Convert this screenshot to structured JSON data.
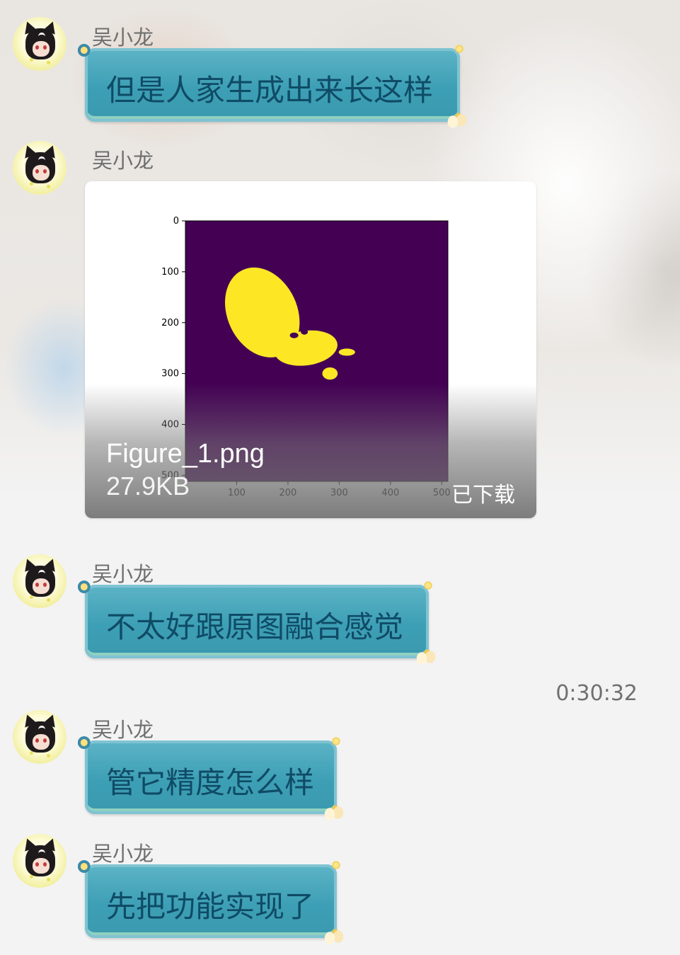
{
  "messages": [
    {
      "sender": "吴小龙",
      "text": "但是人家生成出来长这样"
    },
    {
      "sender": "吴小龙",
      "file": {
        "name": "Figure_1.png",
        "size": "27.9KB",
        "status": "已下载"
      }
    },
    {
      "sender": "吴小龙",
      "text": "不太好跟原图融合感觉"
    },
    {
      "sender": "吴小龙",
      "text": "管它精度怎么样"
    },
    {
      "sender": "吴小龙",
      "text": "先把功能实现了"
    }
  ],
  "timestamp": "0:30:32",
  "chart_data": {
    "type": "heatmap",
    "title": "",
    "xlabel": "",
    "ylabel": "",
    "xticks": [
      "100",
      "200",
      "300",
      "400",
      "500"
    ],
    "yticks": [
      "0",
      "100",
      "200",
      "300",
      "400",
      "500"
    ],
    "xlim": [
      0,
      512
    ],
    "ylim": [
      512,
      0
    ],
    "colormap": "viridis",
    "background_color": "#440154",
    "foreground_color": "#fde725",
    "mask_regions": [
      {
        "label": "main blob",
        "x_range": [
          80,
          215
        ],
        "y_range": [
          92,
          290
        ]
      },
      {
        "label": "lower lobe",
        "x_range": [
          200,
          330
        ],
        "y_range": [
          210,
          318
        ]
      },
      {
        "label": "small fragment",
        "x_range": [
          260,
          300
        ],
        "y_range": [
          288,
          318
        ]
      }
    ]
  },
  "colors": {
    "bubble": "#3d9fb5",
    "bubble_text": "#0f4b66",
    "sender": "#6f6f6f",
    "page": "#f3f3f3"
  }
}
